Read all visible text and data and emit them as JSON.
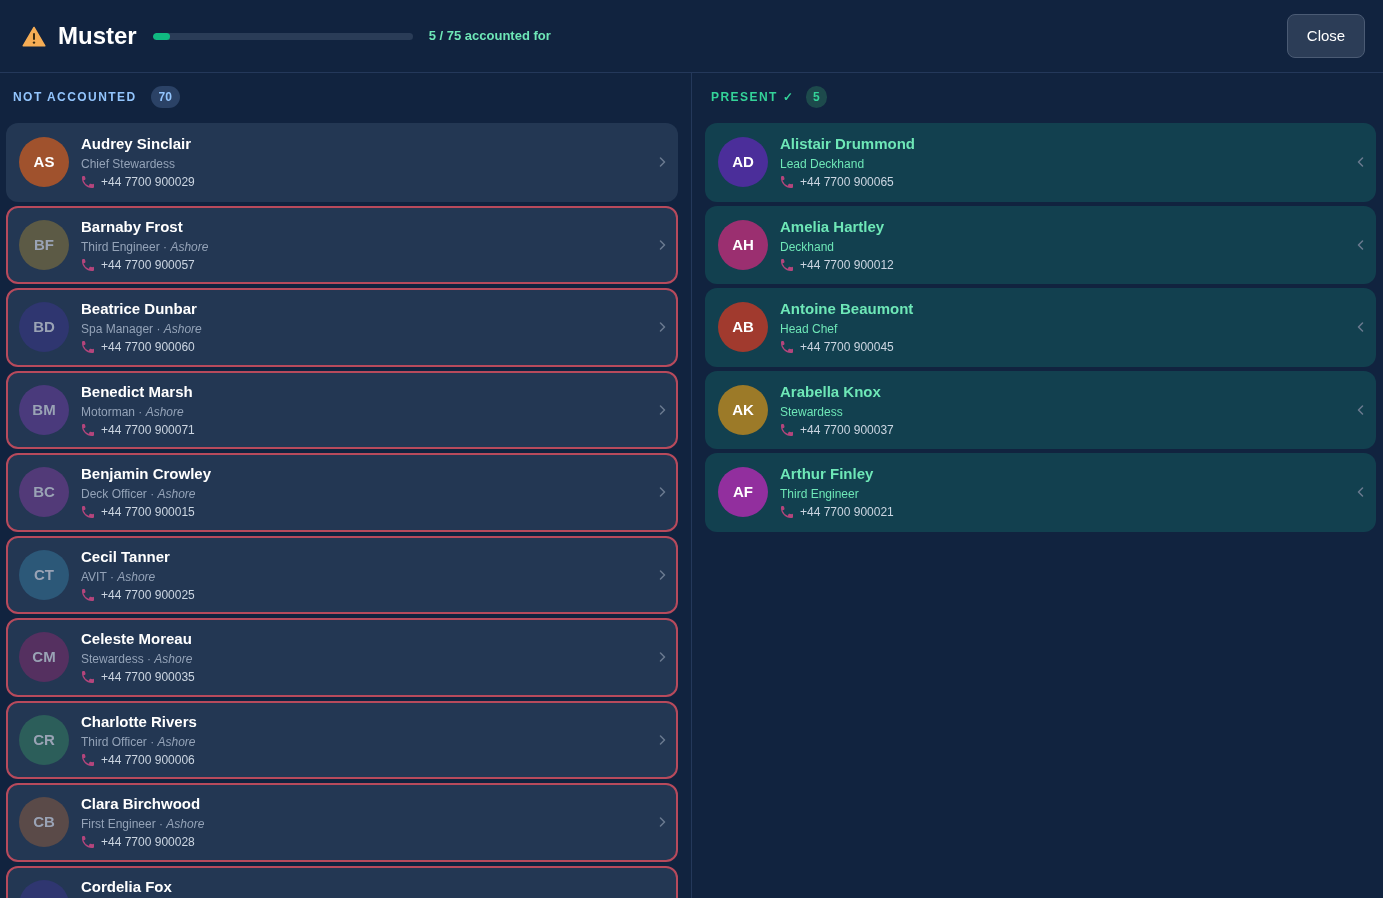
{
  "header": {
    "title": "Muster",
    "progress": {
      "level": 0.067
    },
    "summary": "5 / 75 accounted for",
    "close_button": "Close"
  },
  "columns": [
    {
      "kind": "missing",
      "title": "NOT ACCOUNTED",
      "count": "70",
      "people": [
        {
          "name": "Audrey Sinclair",
          "initials": "AS",
          "color": "#a0522d",
          "role": "Chief Stewardess",
          "phone": "+44 7700 900029",
          "ashore": false
        },
        {
          "name": "Barnaby Frost",
          "initials": "BF",
          "color": "#5c5a45",
          "role": "Third Engineer · *Ashore*",
          "phone": "+44 7700 900057",
          "ashore": true
        },
        {
          "name": "Beatrice Dunbar",
          "initials": "BD",
          "color": "#2f3670",
          "role": "Spa Manager · *Ashore*",
          "phone": "+44 7700 900060",
          "ashore": true
        },
        {
          "name": "Benedict Marsh",
          "initials": "BM",
          "color": "#4a3a7c",
          "role": "Motorman · *Ashore*",
          "phone": "+44 7700 900071",
          "ashore": true
        },
        {
          "name": "Benjamin Crowley",
          "initials": "BC",
          "color": "#523a78",
          "role": "Deck Officer · *Ashore*",
          "phone": "+44 7700 900015",
          "ashore": true
        },
        {
          "name": "Cecil Tanner",
          "initials": "CT",
          "color": "#2c5878",
          "role": "AVIT · *Ashore*",
          "phone": "+44 7700 900025",
          "ashore": true
        },
        {
          "name": "Celeste Moreau",
          "initials": "CM",
          "color": "#553060",
          "role": "Stewardess · *Ashore*",
          "phone": "+44 7700 900035",
          "ashore": true
        },
        {
          "name": "Charlotte Rivers",
          "initials": "CR",
          "color": "#2c5e5a",
          "role": "Third Officer · *Ashore*",
          "phone": "+44 7700 900006",
          "ashore": true
        },
        {
          "name": "Clara Birchwood",
          "initials": "CB",
          "color": "#5a4a48",
          "role": "First Engineer · *Ashore*",
          "phone": "+44 7700 900028",
          "ashore": true
        },
        {
          "name": "Cordelia Fox",
          "color": "#2f3670",
          "ashore": true
        }
      ]
    },
    {
      "kind": "present",
      "title": "PRESENT ✓",
      "count": "5",
      "people": [
        {
          "name": "Alistair Drummond",
          "initials": "AD",
          "color": "#4b2e9a",
          "role": "Lead Deckhand",
          "phone": "+44 7700 900065",
          "ashore": false
        },
        {
          "name": "Amelia Hartley",
          "initials": "AH",
          "color": "#9b2f70",
          "role": "Deckhand",
          "phone": "+44 7700 900012",
          "ashore": false
        },
        {
          "name": "Antoine Beaumont",
          "initials": "AB",
          "color": "#a13a2e",
          "role": "Head Chef",
          "phone": "+44 7700 900045",
          "ashore": false
        },
        {
          "name": "Arabella Knox",
          "initials": "AK",
          "color": "#9c7a28",
          "role": "Stewardess",
          "phone": "+44 7700 900037",
          "ashore": false
        },
        {
          "name": "Arthur Finley",
          "initials": "AF",
          "color": "#922f9e",
          "role": "Third Engineer",
          "phone": "+44 7700 900021",
          "ashore": false
        }
      ]
    }
  ]
}
